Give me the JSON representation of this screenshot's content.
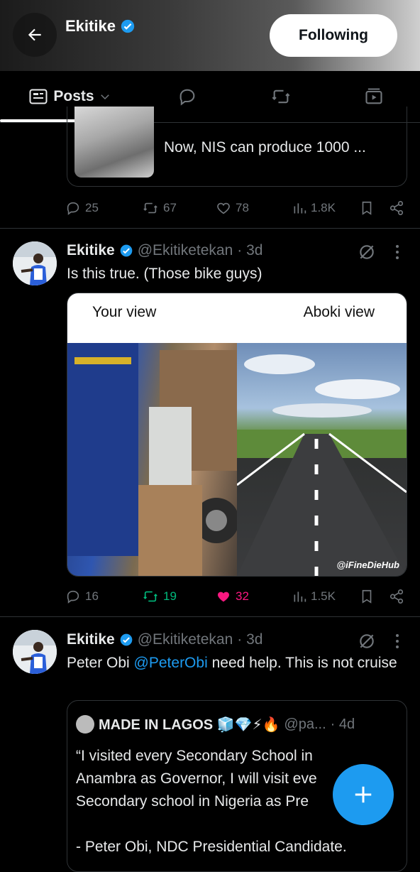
{
  "header": {
    "name": "Ekitike",
    "follow_label": "Following"
  },
  "tabs": {
    "posts_label": "Posts"
  },
  "prev_post": {
    "card_text": "Now,  NIS  can produce 1000 ...",
    "stats": {
      "replies": "25",
      "reposts": "67",
      "likes": "78",
      "views": "1.8K"
    }
  },
  "post1": {
    "name": "Ekitike",
    "handle": "@Ekitiketekan",
    "time": "· 3d",
    "text": "Is this true. (Those bike guys)",
    "media": {
      "left_label": "Your view",
      "right_label": "Aboki view",
      "watermark": "@iFineDieHub"
    },
    "stats": {
      "replies": "16",
      "reposts": "19",
      "likes": "32",
      "views": "1.5K"
    }
  },
  "post2": {
    "name": "Ekitike",
    "handle": "@Ekitiketekan",
    "time": "· 3d",
    "text_before": "Peter Obi ",
    "mention": "@PeterObi",
    "text_after": " need help. This is not cruise",
    "quote": {
      "name": "MADE IN LAGOS 🧊💎⚡🔥",
      "handle": "@pa...",
      "time": "· 4d",
      "line1": "“I visited every Secondary School in",
      "line2": "Anambra as Governor, I will visit eve",
      "line3": "Secondary school in Nigeria as Pre",
      "line4": "- Peter Obi, NDC Presidential Candidate."
    }
  },
  "colors": {
    "accent": "#1d9bf0",
    "like_active": "#f91880",
    "repost_active": "#00ba7c",
    "muted": "#71767b"
  }
}
